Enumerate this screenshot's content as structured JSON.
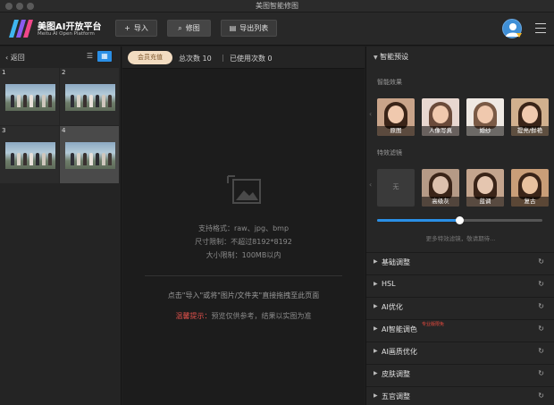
{
  "window": {
    "title": "美图智能修图"
  },
  "header": {
    "brand": "美图AI开放平台",
    "brand_sub": "Meitu AI Open Platform",
    "import_label": "导入",
    "retouch_label": "修图",
    "export_label": "导出列表"
  },
  "left": {
    "back_label": "返回",
    "thumbs": [
      "1",
      "2",
      "3",
      "4"
    ],
    "selected_index": 4
  },
  "center": {
    "vip_label": "会员充值",
    "total_label": "总次数 10",
    "sep": "|",
    "used_label": "已使用次数 0",
    "formats": "支持格式：raw、jpg、bmp",
    "size_limit": "尺寸限制：不超过8192*8192",
    "file_limit": "大小限制：100MB以内",
    "drop_hint": "点击\"导入\"或将\"图片/文件夹\"直接拖拽至此页面",
    "tip_label": "温馨提示：",
    "tip_text": "预览仅供参考，结果以实图为准"
  },
  "right": {
    "section_title": "智能预设",
    "effects_label": "智能效果",
    "effects": [
      "原图",
      "人像写真",
      "婚纱",
      "提亮/鲜艳"
    ],
    "filters_label": "特效滤镜",
    "filters": [
      "无",
      "高级灰",
      "蓝调",
      "复古"
    ],
    "filter_strength": 0.5,
    "more_hint": "更多特效滤镜，敬请期待...",
    "adjustments": [
      {
        "label": "基础调整",
        "badge": ""
      },
      {
        "label": "HSL",
        "badge": ""
      },
      {
        "label": "AI优化",
        "badge": ""
      },
      {
        "label": "AI智能调色",
        "badge": "专业版限免"
      },
      {
        "label": "AI画质优化",
        "badge": ""
      },
      {
        "label": "皮肤调整",
        "badge": ""
      },
      {
        "label": "五官调整",
        "badge": ""
      }
    ],
    "reset_glyph": "↻"
  },
  "colors": {
    "accent": "#2a8fe6",
    "vip_bg": "#f2dcc1",
    "warning": "#e0514b"
  }
}
